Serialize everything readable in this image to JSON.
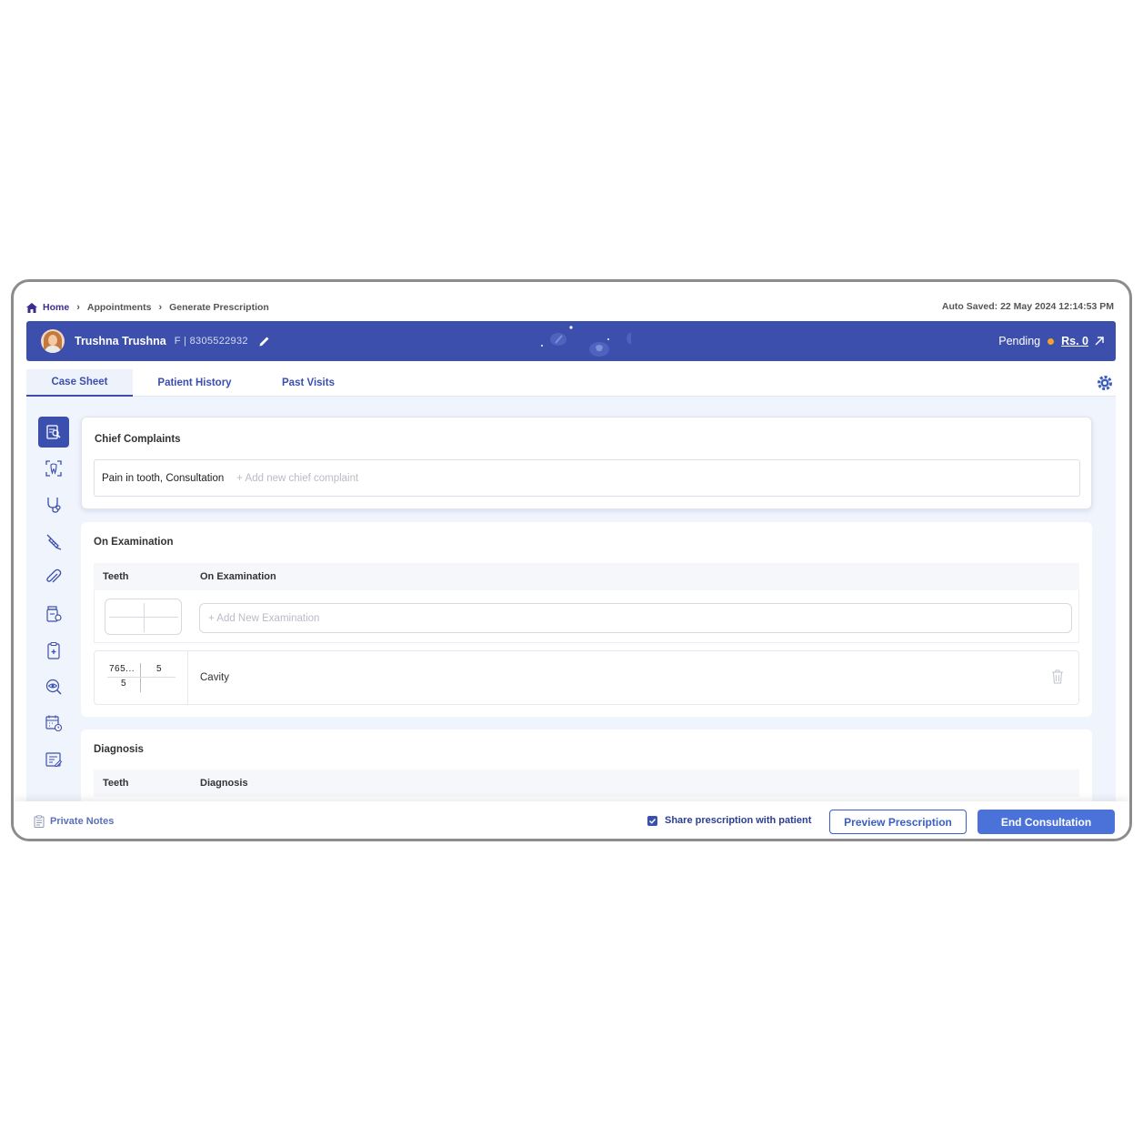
{
  "breadcrumb": {
    "home": "Home",
    "items": [
      "Appointments",
      "Generate Prescription"
    ]
  },
  "autosave": "Auto Saved: 22 May 2024 12:14:53 PM",
  "patient": {
    "name": "Trushna Trushna",
    "meta": "F | 8305522932",
    "status": "Pending",
    "amount": "Rs. 0"
  },
  "tabs": [
    "Case Sheet",
    "Patient History",
    "Past Visits"
  ],
  "sidebar": {
    "items": [
      "case-sheet-icon",
      "scan-icon",
      "stethoscope-icon",
      "syringe-icon",
      "attachment-icon",
      "medicine-icon",
      "clipboard-icon",
      "eye-icon",
      "calendar-icon",
      "notes-icon"
    ]
  },
  "chief_complaints": {
    "title": "Chief Complaints",
    "value": "Pain in tooth, Consultation",
    "placeholder": "+ Add new chief complaint"
  },
  "examination": {
    "title": "On Examination",
    "col_teeth": "Teeth",
    "col_exam": "On Examination",
    "add_placeholder": "+ Add New Examination",
    "rows": [
      {
        "teeth_upper_left": "765...",
        "teeth_upper_right": "5",
        "teeth_lower_left": "5",
        "finding": "Cavity"
      }
    ]
  },
  "diagnosis": {
    "title": "Diagnosis",
    "col_teeth": "Teeth",
    "col_diag": "Diagnosis"
  },
  "footer": {
    "private_notes": "Private Notes",
    "share_label": "Share prescription with patient",
    "share_checked": true,
    "preview": "Preview Prescription",
    "end": "End Consultation"
  },
  "colors": {
    "banner": "#3d4fad",
    "accent": "#3b4fae",
    "primary_button": "#4a72d9",
    "pending_dot": "#f6a22a"
  }
}
